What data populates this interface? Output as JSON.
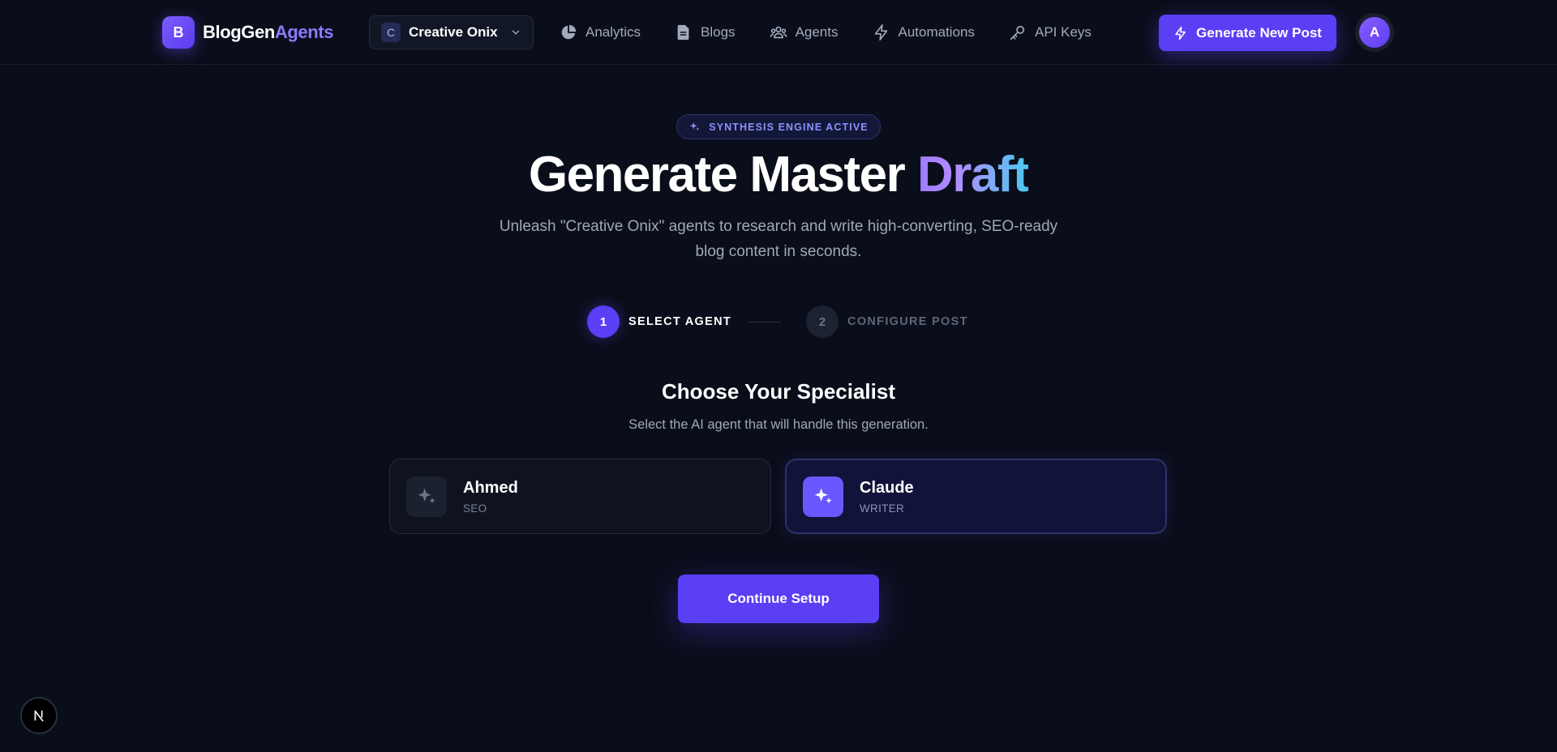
{
  "nav": {
    "logo_letter": "B",
    "logo_primary": "BlogGen",
    "logo_accent": "Agents",
    "workspace_initial": "C",
    "workspace_name": "Creative Onix",
    "items": [
      {
        "label": "Analytics",
        "icon": "pie-chart-icon"
      },
      {
        "label": "Blogs",
        "icon": "document-icon"
      },
      {
        "label": "Agents",
        "icon": "users-icon"
      },
      {
        "label": "Automations",
        "icon": "lightning-icon"
      },
      {
        "label": "API Keys",
        "icon": "key-icon"
      }
    ],
    "cta_label": "Generate New Post",
    "avatar_initial": "A"
  },
  "hero": {
    "badge": "SYNTHESIS ENGINE ACTIVE",
    "title_main": "Generate Master ",
    "title_accent": "Draft",
    "subtitle": "Unleash \"Creative Onix\" agents to research and write high-converting, SEO-ready blog content in seconds."
  },
  "stepper": [
    {
      "number": "1",
      "label": "SELECT AGENT",
      "active": true
    },
    {
      "number": "2",
      "label": "CONFIGURE POST",
      "active": false
    }
  ],
  "specialist": {
    "title": "Choose Your Specialist",
    "subtitle": "Select the AI agent that will handle this generation.",
    "agents": [
      {
        "name": "Ahmed",
        "role": "SEO",
        "selected": false,
        "icon": "sparkles-icon"
      },
      {
        "name": "Claude",
        "role": "WRITER",
        "selected": true,
        "icon": "sparkles-icon"
      }
    ],
    "continue_label": "Continue Setup"
  },
  "colors": {
    "background": "#0a0e1a",
    "accent": "#5a3ff5",
    "accent_text": "#8b7bff",
    "muted_text": "#a0a8b8"
  }
}
